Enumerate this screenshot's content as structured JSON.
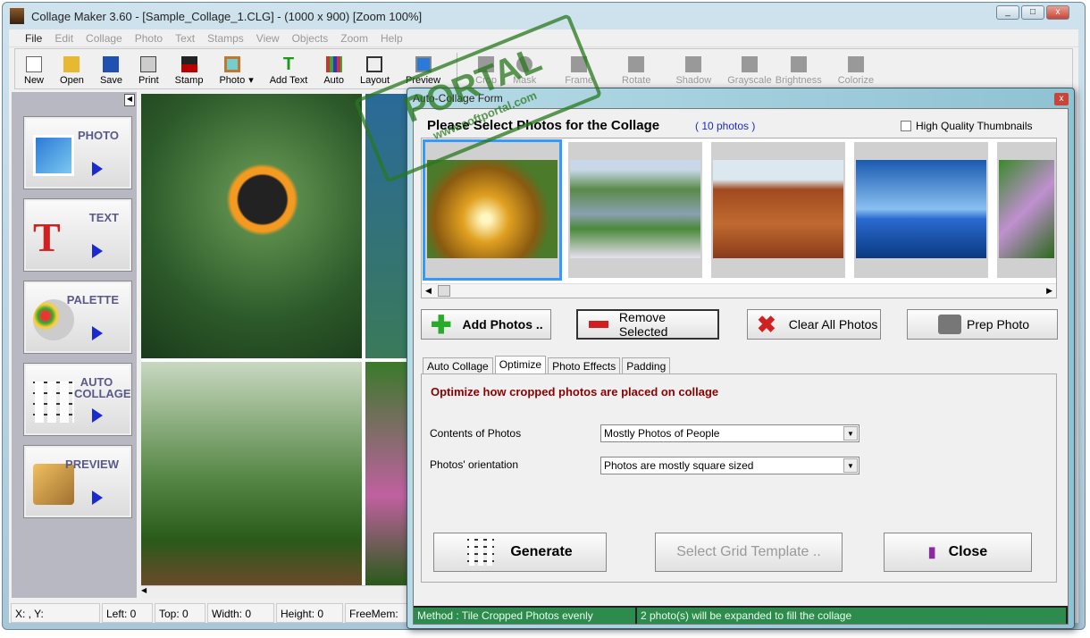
{
  "window": {
    "title": "Collage Maker 3.60  - [Sample_Collage_1.CLG] - (1000 x 900)   [Zoom 100%]"
  },
  "menu": [
    "File",
    "Edit",
    "Collage",
    "Photo",
    "Text",
    "Stamps",
    "View",
    "Objects",
    "Zoom",
    "Help"
  ],
  "toolbar": [
    "New",
    "Open",
    "Save",
    "Print",
    "Stamp",
    "Photo",
    "Add Text",
    "Auto",
    "Layout",
    "Preview"
  ],
  "toolbar_disabled": [
    "Crop",
    "Mask",
    "Frame",
    "Rotate",
    "Shadow",
    "Grayscale",
    "Brightness",
    "Colorize"
  ],
  "left_panel": [
    "PHOTO",
    "TEXT",
    "PALETTE",
    "AUTO COLLAGE",
    "PREVIEW"
  ],
  "status": {
    "xy": "X: , Y:",
    "left": "Left: 0",
    "top": "Top: 0",
    "width": "Width: 0",
    "height": "Height: 0",
    "freemem": "FreeMem:"
  },
  "watermark": {
    "text": "PORTAL",
    "sub": "www.softportal.com"
  },
  "dialog": {
    "title": "Auto-Collage Form",
    "heading": "Please Select Photos for the Collage",
    "count": "( 10 photos )",
    "hq_label": "High Quality Thumbnails",
    "hq_checked": false,
    "thumbnails": [
      {
        "name": "autumn-tree",
        "selected": true
      },
      {
        "name": "stream-meadow",
        "selected": false
      },
      {
        "name": "desert-buttes",
        "selected": false
      },
      {
        "name": "pier-sky",
        "selected": false
      },
      {
        "name": "flowers",
        "selected": false
      }
    ],
    "buttons": {
      "add": "Add Photos  ..",
      "remove": "Remove Selected",
      "clear": "Clear All Photos",
      "prep": "Prep Photo"
    },
    "tabs": [
      "Auto Collage",
      "Optimize",
      "Photo Effects",
      "Padding"
    ],
    "active_tab": "Optimize",
    "optimize_title": "Optimize how cropped photos are placed on collage",
    "contents_label": "Contents of Photos",
    "contents_value": "Mostly Photos of People",
    "orientation_label": "Photos' orientation",
    "orientation_value": "Photos are mostly square sized",
    "generate": "Generate",
    "grid": "Select Grid Template ..",
    "close": "Close",
    "status_method": "Method : Tile Cropped Photos evenly",
    "status_info": "2 photo(s) will be expanded to fill the collage"
  }
}
